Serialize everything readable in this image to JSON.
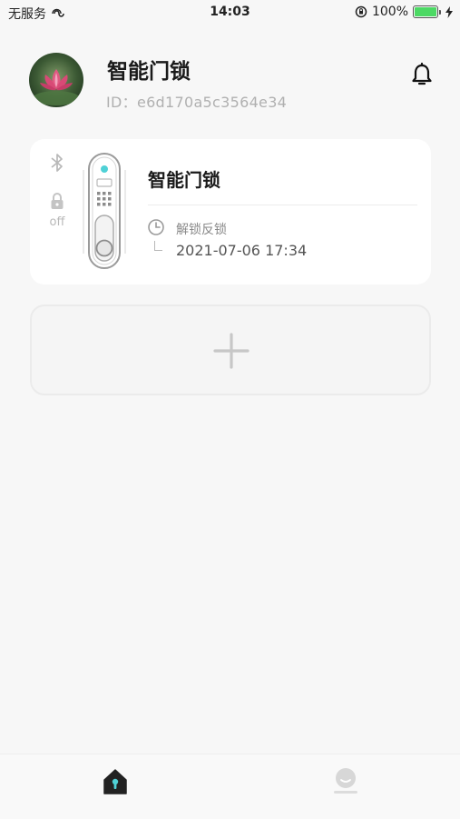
{
  "status_bar": {
    "carrier": "无服务",
    "time": "14:03",
    "battery_percent": "100%",
    "battery_level": 1.0
  },
  "header": {
    "title": "智能门锁",
    "device_id": "ID：e6d170a5c3564e34"
  },
  "device_card": {
    "name": "智能门锁",
    "lock_state": "off",
    "last_event_label": "解锁反锁",
    "last_event_time": "2021-07-06 17:34"
  },
  "colors": {
    "accent": "#4fd1d6",
    "background": "#f7f7f7",
    "card": "#ffffff",
    "battery": "#4cd964"
  },
  "icons": {
    "bell": "bell-icon",
    "bluetooth": "bluetooth-icon",
    "lock": "lock-icon",
    "clock": "clock-icon",
    "add": "plus-icon",
    "home": "home-icon",
    "profile": "profile-icon"
  },
  "tabbar": {
    "active_tab": "home"
  }
}
